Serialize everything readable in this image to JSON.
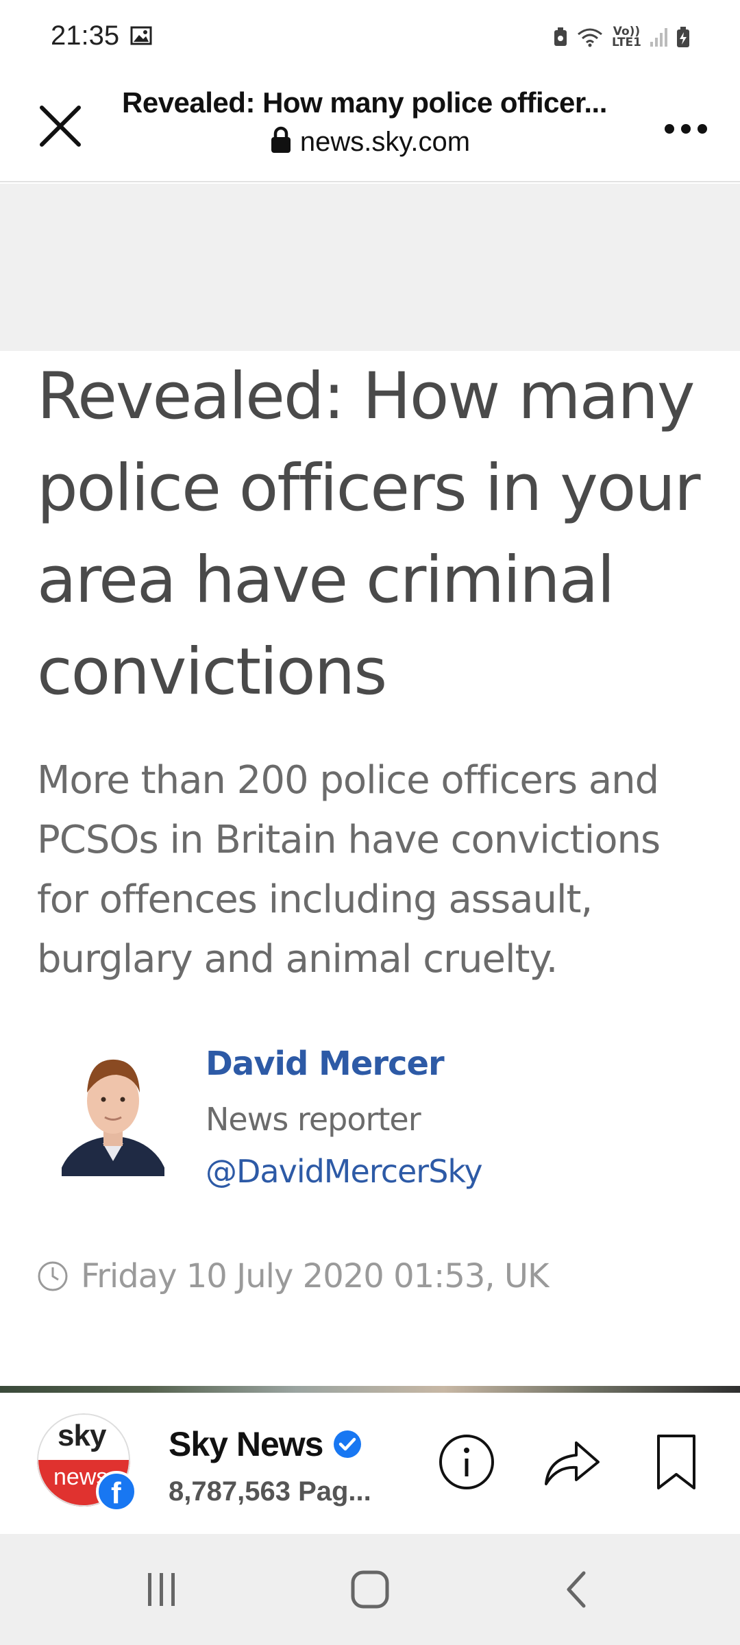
{
  "status_bar": {
    "time": "21:35",
    "network_label_top": "Vo))",
    "network_label_bottom": "LTE1",
    "icons": [
      "image-icon",
      "battery-saver-icon",
      "wifi-icon",
      "signal-icon",
      "battery-charging-icon"
    ]
  },
  "browser": {
    "title": "Revealed: How many police officer...",
    "url": "news.sky.com",
    "icons": [
      "close-icon",
      "lock-icon",
      "more-icon"
    ]
  },
  "article": {
    "headline": "Revealed: How many police officers in your area have criminal convictions",
    "standfirst": "More than 200 police officers and PCSOs in Britain have convictions for offences including assault, burglary and animal cruelty.",
    "author": {
      "name": "David Mercer",
      "role": "News reporter",
      "handle": "@DavidMercerSky"
    },
    "date": "Friday 10 July 2020 01:53, UK"
  },
  "page_bar": {
    "logo_top": "sky",
    "logo_bottom": "news",
    "name": "Sky News",
    "followers": "8,787,563 Pag...",
    "icons": [
      "info-icon",
      "share-icon",
      "bookmark-icon"
    ]
  },
  "nav": {
    "icons": [
      "recents-icon",
      "home-icon",
      "back-icon"
    ]
  },
  "colors": {
    "link_blue": "#2d5aa6",
    "headline_grey": "#4a4a4a",
    "facebook_blue": "#1877f2",
    "sky_red": "#e0322f"
  }
}
